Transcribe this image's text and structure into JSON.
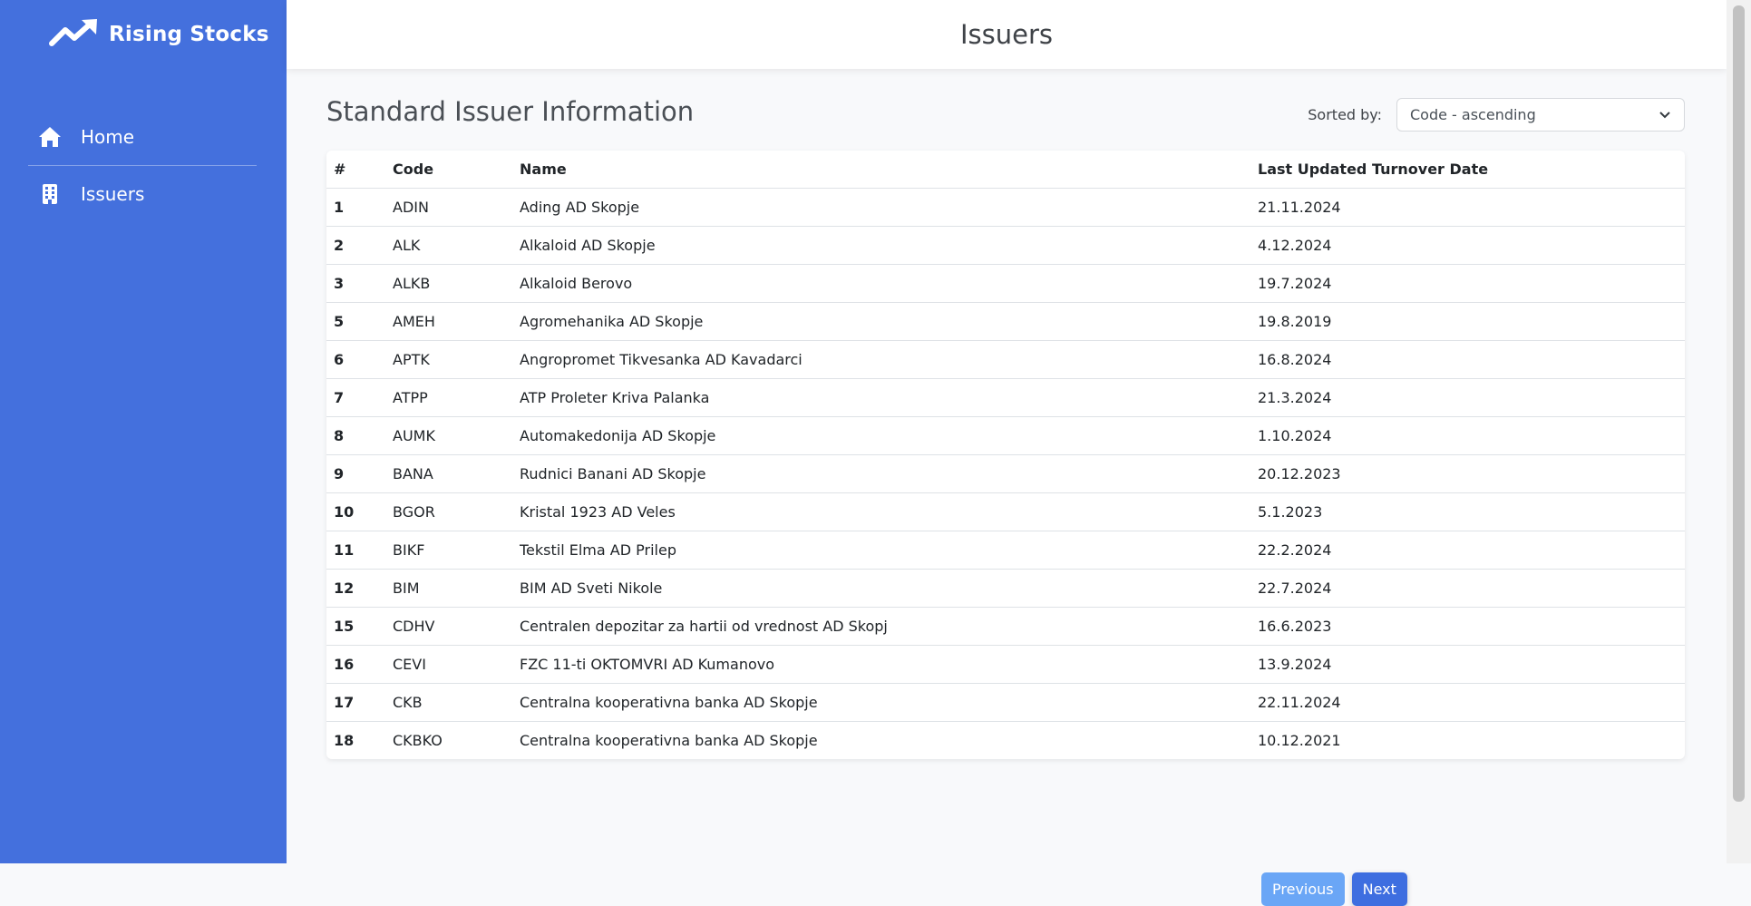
{
  "brand": {
    "name": "Rising Stocks",
    "icon": "trending-up-icon"
  },
  "sidebar": {
    "items": [
      {
        "label": "Home",
        "icon": "home-icon"
      },
      {
        "label": "Issuers",
        "icon": "building-icon"
      }
    ]
  },
  "header": {
    "title": "Issuers"
  },
  "main": {
    "heading": "Standard Issuer Information",
    "sort_label": "Sorted by:",
    "sort_value": "Code - ascending"
  },
  "table": {
    "columns": [
      "#",
      "Code",
      "Name",
      "Last Updated Turnover Date"
    ],
    "rows": [
      [
        "1",
        "ADIN",
        "Ading AD Skopje",
        "21.11.2024"
      ],
      [
        "2",
        "ALK",
        "Alkaloid AD Skopje",
        "4.12.2024"
      ],
      [
        "3",
        "ALKB",
        "Alkaloid Berovo",
        "19.7.2024"
      ],
      [
        "5",
        "AMEH",
        "Agromehanika AD Skopje",
        "19.8.2019"
      ],
      [
        "6",
        "APTK",
        "Angropromet Tikvesanka AD Kavadarci",
        "16.8.2024"
      ],
      [
        "7",
        "ATPP",
        "ATP Proleter Kriva Palanka",
        "21.3.2024"
      ],
      [
        "8",
        "AUMK",
        "Automakedonija AD Skopje",
        "1.10.2024"
      ],
      [
        "9",
        "BANA",
        "Rudnici Banani AD Skopje",
        "20.12.2023"
      ],
      [
        "10",
        "BGOR",
        "Kristal 1923 AD Veles",
        "5.1.2023"
      ],
      [
        "11",
        "BIKF",
        "Tekstil Elma AD Prilep",
        "22.2.2024"
      ],
      [
        "12",
        "BIM",
        "BIM AD Sveti Nikole",
        "22.7.2024"
      ],
      [
        "15",
        "CDHV",
        "Centralen depozitar za hartii od vrednost AD Skopj",
        "16.6.2023"
      ],
      [
        "16",
        "CEVI",
        "FZC 11-ti OKTOMVRI AD Kumanovo",
        "13.9.2024"
      ],
      [
        "17",
        "CKB",
        "Centralna kooperativna banka AD Skopje",
        "22.11.2024"
      ],
      [
        "18",
        "CKBKO",
        "Centralna kooperativna banka AD Skopje",
        "10.12.2021"
      ]
    ]
  },
  "pagination": {
    "previous_label": "Previous",
    "next_label": "Next"
  },
  "colors": {
    "sidebar": "#4470dd",
    "prev_button": "#6aa6f6",
    "next_button": "#3e6ee0"
  }
}
